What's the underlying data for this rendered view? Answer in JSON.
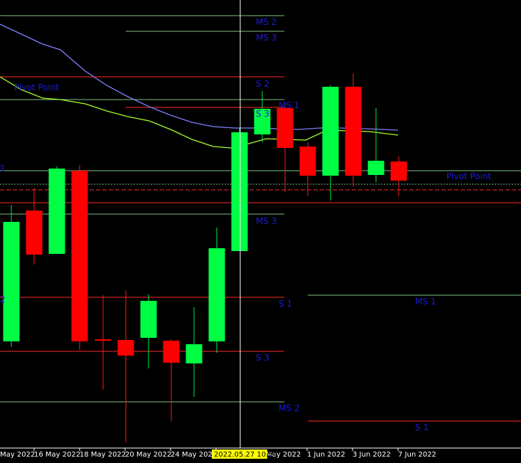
{
  "chart_data": {
    "type": "candlestick",
    "colors": {
      "background": "#000000",
      "bull": "#00ff44",
      "bear": "#ff0000",
      "wick_bull": "#00ee44",
      "wick_bear": "#ff1a1a",
      "pivot_label": "#1c1cd8",
      "ma_fast": "#7f7fff",
      "ma_slow": "#a8ff2a",
      "cursor": "#ffffff",
      "cursor_date_bg": "#ffff00"
    },
    "candles": [
      {
        "open": 0.0,
        "high": 0.0,
        "low": 0.0,
        "close": 0.0,
        "dir": "bull",
        "o": 480,
        "h": 288,
        "l": 488,
        "c": 312
      },
      {
        "open": 0.0,
        "high": 0.0,
        "low": 0.0,
        "close": 0.0,
        "dir": "bear",
        "o": 296,
        "h": 264,
        "l": 372,
        "c": 358
      },
      {
        "open": 0.0,
        "high": 0.0,
        "low": 0.0,
        "close": 0.0,
        "dir": "bull",
        "o": 357,
        "h": 234,
        "l": 357,
        "c": 237
      },
      {
        "open": 0.0,
        "high": 0.0,
        "low": 0.0,
        "close": 0.0,
        "dir": "bear",
        "o": 240,
        "h": 232,
        "l": 492,
        "c": 480
      },
      {
        "open": 0.0,
        "high": 0.0,
        "low": 0.0,
        "close": 0.0,
        "dir": "bear",
        "o": 477,
        "h": 415,
        "l": 548,
        "c": 478
      },
      {
        "open": 0.0,
        "high": 0.0,
        "low": 0.0,
        "close": 0.0,
        "dir": "bear",
        "o": 478,
        "h": 408,
        "l": 622,
        "c": 500
      },
      {
        "open": 0.0,
        "high": 0.0,
        "low": 0.0,
        "close": 0.0,
        "dir": "bull",
        "o": 475,
        "h": 414,
        "l": 518,
        "c": 423
      },
      {
        "open": 0.0,
        "high": 0.0,
        "low": 0.0,
        "close": 0.0,
        "dir": "bear",
        "o": 479,
        "h": 477,
        "l": 592,
        "c": 510
      },
      {
        "open": 0.0,
        "high": 0.0,
        "low": 0.0,
        "close": 0.0,
        "dir": "bull",
        "o": 511,
        "h": 432,
        "l": 558,
        "c": 484
      },
      {
        "open": 0.0,
        "high": 0.0,
        "low": 0.0,
        "close": 0.0,
        "dir": "bull",
        "o": 480,
        "h": 320,
        "l": 496,
        "c": 349
      },
      {
        "open": 0.0,
        "high": 0.0,
        "low": 0.0,
        "close": 0.0,
        "dir": "bull",
        "o": 353,
        "h": 180,
        "l": 353,
        "c": 186
      },
      {
        "open": 0.0,
        "high": 0.0,
        "low": 0.0,
        "close": 0.0,
        "dir": "bull",
        "o": 189,
        "h": 128,
        "l": 200,
        "c": 153
      },
      {
        "open": 0.0,
        "high": 0.0,
        "low": 0.0,
        "close": 0.0,
        "dir": "bear",
        "o": 152,
        "h": 146,
        "l": 270,
        "c": 208
      },
      {
        "open": 0.0,
        "high": 0.0,
        "low": 0.0,
        "close": 0.0,
        "dir": "bear",
        "o": 206,
        "h": 200,
        "l": 276,
        "c": 247
      },
      {
        "open": 0.0,
        "high": 0.0,
        "low": 0.0,
        "close": 0.0,
        "dir": "bull",
        "o": 247,
        "h": 120,
        "l": 282,
        "c": 122
      },
      {
        "open": 0.0,
        "high": 0.0,
        "low": 0.0,
        "close": 0.0,
        "dir": "bear",
        "o": 122,
        "h": 103,
        "l": 262,
        "c": 247
      },
      {
        "open": 0.0,
        "high": 0.0,
        "low": 0.0,
        "close": 0.0,
        "dir": "bull",
        "o": 246,
        "h": 152,
        "l": 256,
        "c": 226
      },
      {
        "open": 0.0,
        "high": 0.0,
        "low": 0.0,
        "close": 0.0,
        "dir": "bear",
        "o": 227,
        "h": 220,
        "l": 276,
        "c": 254
      }
    ],
    "date_labels": [
      "May 2022",
      "16 May 2022",
      "18 May 2022",
      "20 May 2022",
      "24 May 2022",
      "May 2022",
      "1 Jun 2022",
      "3 Jun 2022",
      "7 Jun 2022"
    ],
    "cursor_date": "2022.05.27 10:54",
    "level_labels": [
      "MS 2",
      "MS 3",
      "Pivot Point",
      "S 2",
      "S 3",
      "MS 1",
      "1",
      "Pivot Point",
      "MS 3",
      "2",
      "S 1",
      "MS 1",
      "S 3",
      "MS 2",
      "S 1"
    ]
  }
}
